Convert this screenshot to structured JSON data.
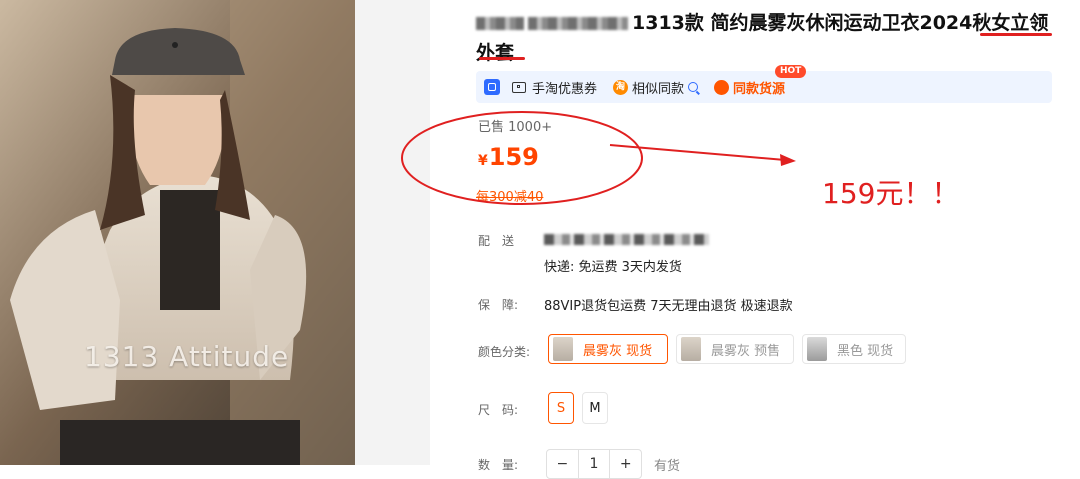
{
  "product": {
    "title_visible": "1313款 简约晨雾灰休闲运动卫衣2024秋女立领外套",
    "photo_caption": "1313 Attitude"
  },
  "promo_bar": {
    "coupon_label": "手淘优惠券",
    "similar_label": "相似同款",
    "source_label": "同款货源",
    "hot_badge": "HOT"
  },
  "sales": {
    "sold": "已售 1000+"
  },
  "price": {
    "currency": "¥",
    "amount": "159",
    "promo": "每300减40"
  },
  "delivery": {
    "label": "配　送",
    "shipping": "快递: 免运费  3天内发货"
  },
  "guarantee": {
    "label": "保　障:",
    "text": "88VIP退货包运费 7天无理由退货 极速退款"
  },
  "color": {
    "label": "颜色分类:",
    "options": [
      {
        "label": "晨雾灰 现货",
        "selected": true
      },
      {
        "label": "晨雾灰 预售",
        "selected": false
      },
      {
        "label": "黑色 现货",
        "selected": false
      }
    ]
  },
  "size": {
    "label": "尺　码:",
    "options": [
      {
        "label": "S",
        "selected": true
      },
      {
        "label": "M",
        "selected": false
      }
    ]
  },
  "quantity": {
    "label": "数　量:",
    "value": "1",
    "minus": "−",
    "plus": "+",
    "stock": "有货"
  },
  "annotation": {
    "text": "159元！！",
    "color": "#e02020"
  },
  "colors": {
    "accent": "#ff5500",
    "price": "#ff4400",
    "promo_bar_bg": "#eef4ff"
  }
}
